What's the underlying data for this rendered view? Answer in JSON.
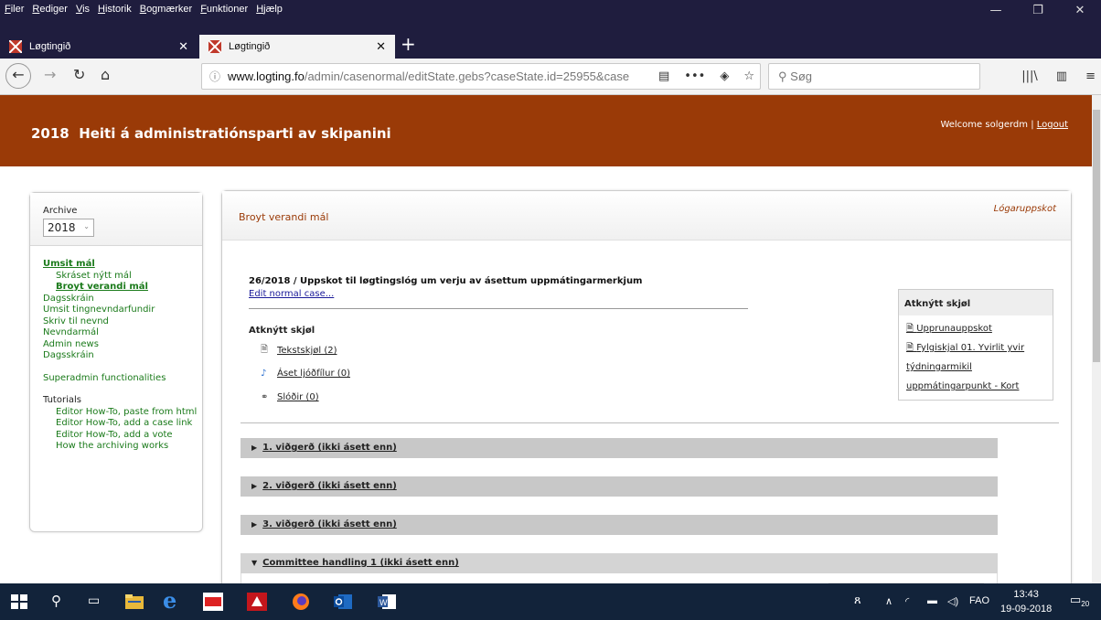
{
  "browser": {
    "menu": [
      "Filer",
      "Rediger",
      "Vis",
      "Historik",
      "Bogmærker",
      "Funktioner",
      "Hjælp"
    ],
    "tabs": [
      {
        "title": "Løgtingið",
        "active": false
      },
      {
        "title": "Løgtingið",
        "active": true
      }
    ],
    "url": {
      "host": "www.logting.fo",
      "path": "/admin/casenormal/editState.gebs?caseState.id=25955&case"
    },
    "search_placeholder": "Søg"
  },
  "header": {
    "title": "2018  Heiti á administratiónsparti av skipanini",
    "welcome": "Welcome solgerdm",
    "logout": "Logout"
  },
  "sidebar": {
    "archive_label": "Archive",
    "year": "2018",
    "items": [
      {
        "label": "Umsit mál",
        "style": "header"
      },
      {
        "label": "Skráset nýtt mál",
        "style": "indent"
      },
      {
        "label": "Broyt verandi mál",
        "style": "indent-active"
      },
      {
        "label": "Dagsskráin"
      },
      {
        "label": "Umsit tingnevndarfundir"
      },
      {
        "label": "Skriv til nevnd"
      },
      {
        "label": "Nevndarmál"
      },
      {
        "label": "Admin news"
      },
      {
        "label": "Dagsskráin"
      }
    ],
    "superadmin": "Superadmin functionalities",
    "tutorials_label": "Tutorials",
    "tutorials": [
      "Editor How-To, paste from html",
      "Editor How-To, add a case link",
      "Editor How-To, add a vote",
      "How the archiving works"
    ]
  },
  "main": {
    "heading": "Broyt verandi mál",
    "tag": "Lógaruppskot",
    "case_title": "26/2018 / Uppskot til løgtingslóg um verju av ásettum uppmátingarmerkjum",
    "edit_link": "Edit normal case...",
    "attachments_title": "Atknýtt skjøl",
    "attachments": [
      {
        "icon": "document-icon",
        "label": "Tekstskjøl (2)"
      },
      {
        "icon": "audio-icon",
        "label": "Áset ljóðfílur (0)"
      },
      {
        "icon": "link-icon",
        "label": "Slóðir (0)"
      }
    ],
    "right_box": {
      "title": "Atknýtt skjøl",
      "links": [
        "Upprunauppskot",
        "Fylgiskjal 01. Yvirlit yvir týdningarmikil uppmátingarpunkt - Kort"
      ]
    },
    "sections": [
      {
        "label": "1. viðgerð (ikki ásett enn)",
        "open": false
      },
      {
        "label": "2. viðgerð (ikki ásett enn)",
        "open": false
      },
      {
        "label": "3. viðgerð (ikki ásett enn)",
        "open": false
      },
      {
        "label": "Committee handling 1 (ikki ásett enn)",
        "open": true
      }
    ]
  },
  "taskbar": {
    "lang": "FAO",
    "time": "13:43",
    "date": "19-09-2018",
    "notifications": "20"
  }
}
